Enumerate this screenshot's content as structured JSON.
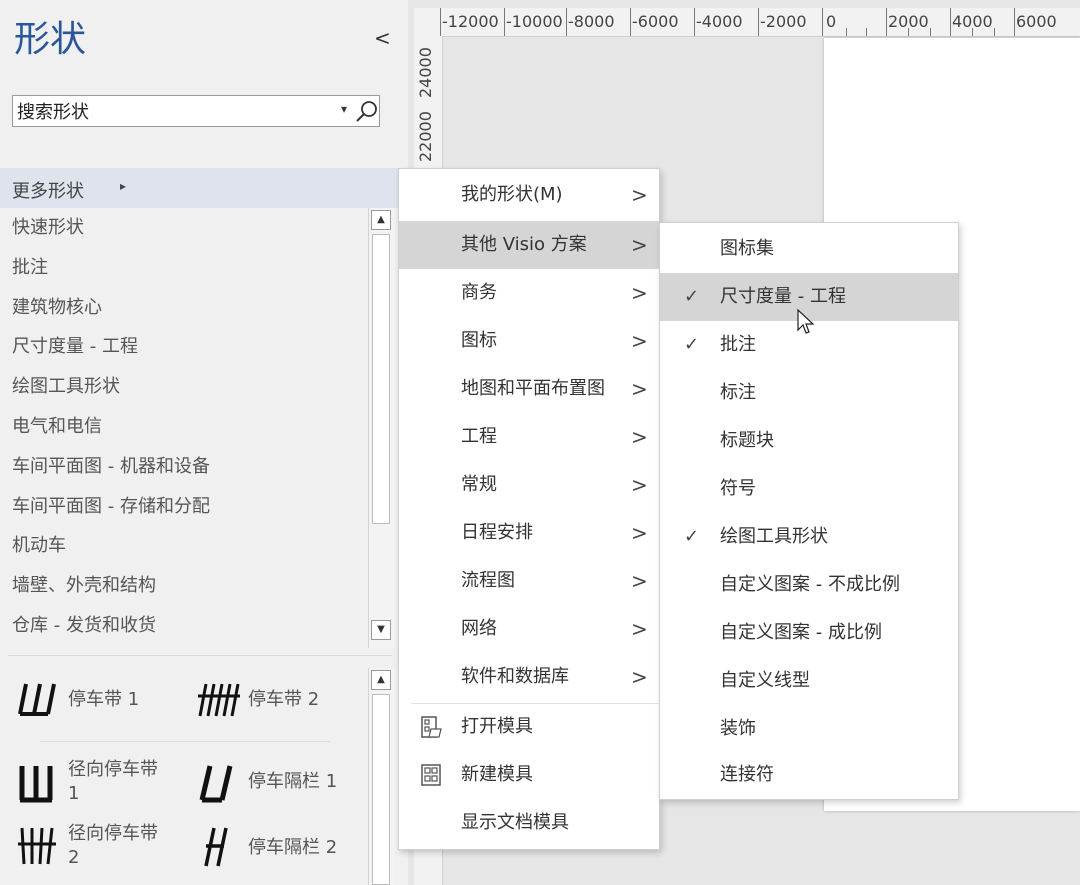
{
  "pane": {
    "title": "形状",
    "collapse": "<",
    "search": {
      "value": "搜索形状",
      "placeholder": "搜索形状"
    },
    "more_shapes": "更多形状",
    "stencils": [
      "快速形状",
      "批注",
      "建筑物核心",
      "尺寸度量 - 工程",
      "绘图工具形状",
      "电气和电信",
      "车间平面图 - 机器和设备",
      "车间平面图 - 存储和分配",
      "机动车",
      "墙壁、外壳和结构",
      "仓库 - 发货和收货"
    ],
    "shapes": [
      {
        "label": "停车带 1",
        "icon": "parking-strip-1-icon"
      },
      {
        "label": "停车带 2",
        "icon": "parking-strip-2-icon"
      },
      {
        "label": "径向停车带\n1",
        "icon": "radial-parking-strip-1-icon"
      },
      {
        "label": "停车隔栏 1",
        "icon": "parking-divider-1-icon"
      },
      {
        "label": "径向停车带\n2",
        "icon": "radial-parking-strip-2-icon"
      },
      {
        "label": "停车隔栏 2",
        "icon": "parking-divider-2-icon"
      }
    ]
  },
  "ruler": {
    "top": [
      "-12000",
      "-10000",
      "-8000",
      "-6000",
      "-4000",
      "-2000",
      "0",
      "2000",
      "4000",
      "6000"
    ],
    "left": [
      "24000",
      "22000"
    ]
  },
  "menu1": {
    "items": [
      {
        "label": "我的形状(M)",
        "arrow": ">"
      },
      {
        "label": "其他 Visio 方案",
        "arrow": ">"
      },
      {
        "label": "商务",
        "arrow": ">"
      },
      {
        "label": "图标",
        "arrow": ">"
      },
      {
        "label": "地图和平面布置图",
        "arrow": ">"
      },
      {
        "label": "工程",
        "arrow": ">"
      },
      {
        "label": "常规",
        "arrow": ">"
      },
      {
        "label": "日程安排",
        "arrow": ">"
      },
      {
        "label": "流程图",
        "arrow": ">"
      },
      {
        "label": "网络",
        "arrow": ">"
      },
      {
        "label": "软件和数据库",
        "arrow": ">"
      }
    ],
    "actions": [
      {
        "label": "打开模具",
        "icon": "open-stencil-icon"
      },
      {
        "label": "新建模具",
        "icon": "new-stencil-icon"
      },
      {
        "label": "显示文档模具",
        "icon": ""
      }
    ]
  },
  "menu2": {
    "items": [
      {
        "label": "图标集",
        "checked": ""
      },
      {
        "label": "尺寸度量 - 工程",
        "checked": "✓"
      },
      {
        "label": "批注",
        "checked": "✓"
      },
      {
        "label": "标注",
        "checked": ""
      },
      {
        "label": "标题块",
        "checked": ""
      },
      {
        "label": "符号",
        "checked": ""
      },
      {
        "label": "绘图工具形状",
        "checked": "✓"
      },
      {
        "label": "自定义图案 - 不成比例",
        "checked": ""
      },
      {
        "label": "自定义图案 - 成比例",
        "checked": ""
      },
      {
        "label": "自定义线型",
        "checked": ""
      },
      {
        "label": "装饰",
        "checked": ""
      },
      {
        "label": "连接符",
        "checked": ""
      }
    ]
  }
}
